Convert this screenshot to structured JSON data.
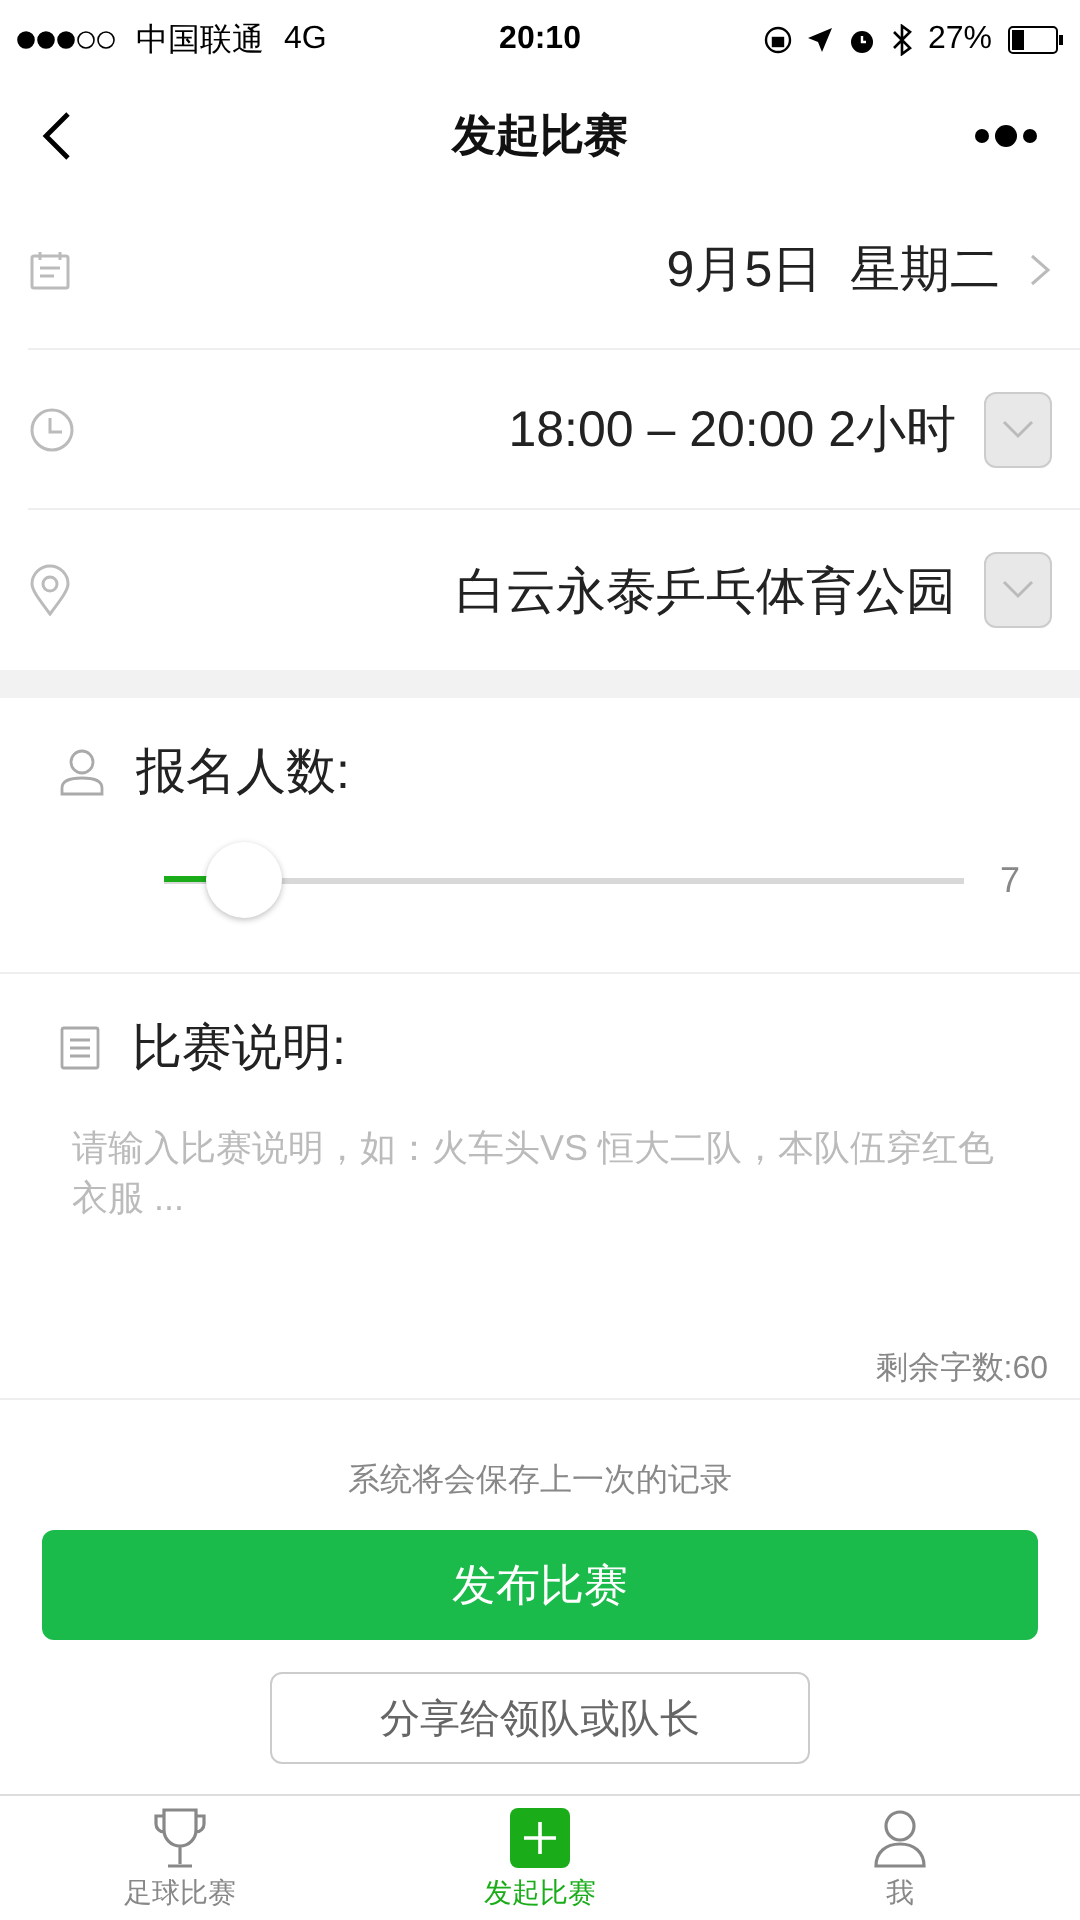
{
  "status_bar": {
    "carrier": "中国联通",
    "network": "4G",
    "time": "20:10",
    "battery": "27%"
  },
  "nav": {
    "title": "发起比赛"
  },
  "info_rows": [
    {
      "kind": "date",
      "value": "9月5日  星期二"
    },
    {
      "kind": "time",
      "value": "18:00 – 20:00 2小时"
    },
    {
      "kind": "location",
      "value": "白云永泰乒乓体育公园"
    }
  ],
  "participants": {
    "label": "报名人数:",
    "level": 0.1,
    "value": "7"
  },
  "description": {
    "label": "比赛说明:",
    "placeholder": "请输入比赛说明，如：火车头VS 恒大二队，本队伍穿红色衣服 ...",
    "counter": "剩余字数:60"
  },
  "note": "系统将会保存上一次的记录",
  "publish_button": "发布比赛",
  "share_button": "分享给领队或队长",
  "tab_bar": [
    {
      "label": "足球比赛",
      "kind": "matches",
      "selected": false
    },
    {
      "label": "发起比赛",
      "kind": "create",
      "selected": true
    },
    {
      "label": "我",
      "kind": "me",
      "selected": false
    }
  ]
}
